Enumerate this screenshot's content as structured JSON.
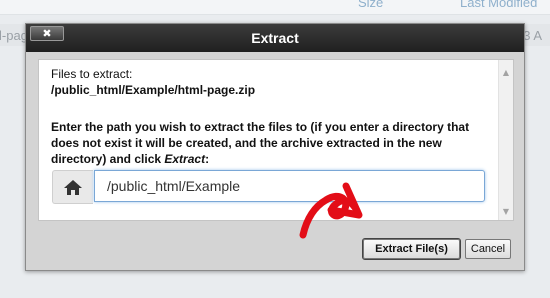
{
  "background": {
    "columns": {
      "size": "Size",
      "last_modified": "Last Modified"
    },
    "row": {
      "name_fragment": "l-pag",
      "time_fragment": "33 A"
    }
  },
  "dialog": {
    "title": "Extract",
    "close_symbol": "✖",
    "files_label": "Files to extract:",
    "file_path": "/public_html/Example/html-page.zip",
    "instructions_text": "Enter the path you wish to extract the files to (if you enter a directory that does not exist it will be created, and the archive extracted in the new directory) and click ",
    "instructions_emph": "Extract",
    "instructions_end": ":",
    "home_icon": "home-icon",
    "path_value": "/public_html/Example",
    "extract_button": "Extract File(s)",
    "cancel_button": "Cancel"
  },
  "colors": {
    "titlebar": "#2b2b2b",
    "arrow": "#e30d17",
    "input_focus": "#7aa7d6"
  }
}
